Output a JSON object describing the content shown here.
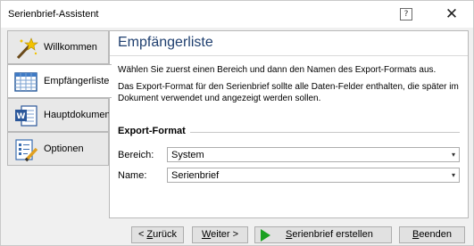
{
  "window": {
    "title": "Serienbrief-Assistent",
    "help_glyph": "?",
    "close_glyph": "✕"
  },
  "sidebar": {
    "items": [
      {
        "label": "Willkommen",
        "icon": "wand-icon",
        "active": false
      },
      {
        "label": "Empfängerliste",
        "icon": "table-grid-icon",
        "active": true
      },
      {
        "label": "Hauptdokument",
        "icon": "word-document-icon",
        "active": false
      },
      {
        "label": "Optionen",
        "icon": "checklist-pencil-icon",
        "active": false
      }
    ]
  },
  "main": {
    "heading": "Empfängerliste",
    "desc1": "Wählen Sie zuerst einen Bereich und dann den Namen des Export-Formats aus.",
    "desc2": "Das Export-Format für den Serienbrief sollte alle Daten-Felder enthalten, die später im Dokument verwendet und angezeigt werden sollen.",
    "group_title": "Export-Format",
    "fields": {
      "bereich": {
        "label": "Bereich:",
        "value": "System"
      },
      "name": {
        "label": "Name:",
        "value": "Serienbrief"
      }
    }
  },
  "footer": {
    "back": {
      "mnemonic": "Z",
      "rest": "urück",
      "prefix": "< "
    },
    "next": {
      "mnemonic": "W",
      "rest": "eiter >"
    },
    "start": {
      "mnemonic": "S",
      "rest": "erienbrief erstellen"
    },
    "finish": {
      "mnemonic": "B",
      "rest": "eenden"
    }
  },
  "colors": {
    "heading": "#1f3f6f",
    "play_accent": "#1aa021"
  }
}
